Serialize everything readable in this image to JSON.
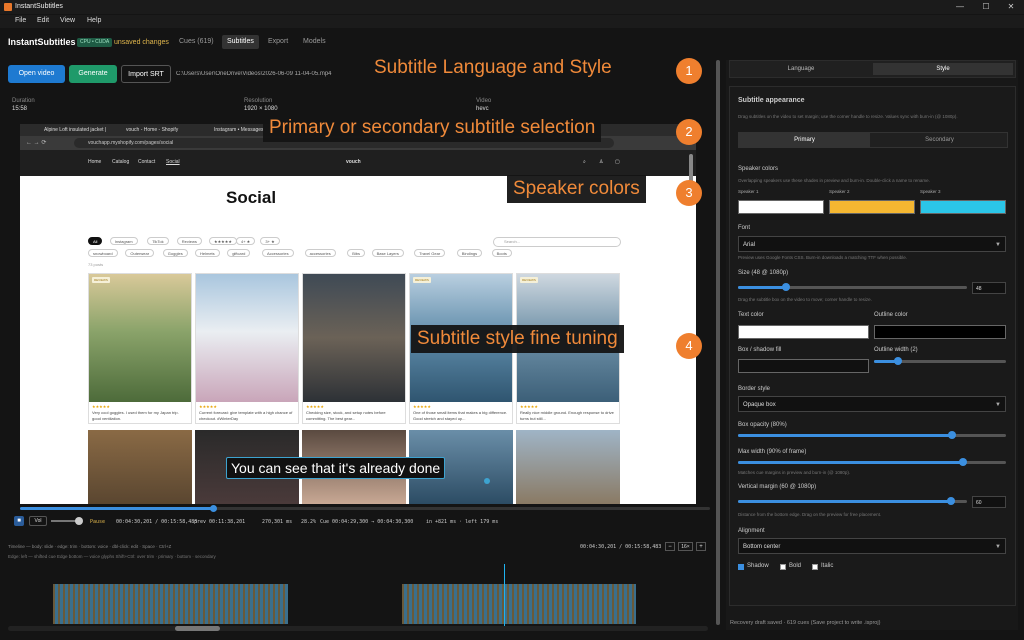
{
  "window": {
    "title": "InstantSubtitles"
  },
  "menu": [
    "File",
    "Edit",
    "View",
    "Help"
  ],
  "appbar": {
    "brand": "InstantSubtitles",
    "badge": "CPU • CUDA",
    "unsaved": "unsaved changes",
    "tabs": [
      "Cues (619)",
      "Subtitles",
      "Export",
      "Models"
    ],
    "active_tab": "Subtitles"
  },
  "toolbar": {
    "open_video": "Open video",
    "generate": "Generate",
    "import_srt": "Import SRT",
    "path": "C:\\Users\\User\\OneDrive\\Videos\\2026-06-09 11-04-05.mp4"
  },
  "info": {
    "duration_label": "Duration",
    "duration_value": "15:58",
    "resolution_label": "Resolution",
    "resolution_value": "1920 × 1080",
    "video_label": "Video",
    "video_value": "hevc"
  },
  "preview": {
    "browser_tabs": [
      "Alpine Loft insulated jacket |",
      "vouch - Home - Shopify",
      "Instagram • Messages"
    ],
    "url": "vouchapp.myshopify.com/pages/social",
    "site_nav": [
      "Home",
      "Catalog",
      "Contact",
      "Social"
    ],
    "site_logo": "vouch",
    "heading": "Social",
    "chips_row1": [
      "All",
      "Instagram",
      "TikTok",
      "Reviews",
      "★★★★★",
      "4+ ★",
      "3+ ★"
    ],
    "chips_row2": [
      "snowboard",
      "Outerwear",
      "Goggles",
      "Helmets",
      "giftcard",
      "Accessories",
      "accessories",
      "Bibs",
      "Base Layers",
      "Travel Gear",
      "Bindings",
      "Boots"
    ],
    "search_placeholder": "Search...",
    "count": "73 posts",
    "cards": [
      {
        "stars": "★★★★★",
        "text": "Very cool goggles. I used them for my Japan trip. good ventilation."
      },
      {
        "stars": "★★★★★",
        "text": "Current forecast: give template with a high chance of checkout. #WinterDay"
      },
      {
        "stars": "★★★★★",
        "text": "Checking size, stock, and setup notes before committing. The best gear..."
      },
      {
        "stars": "★★★★★",
        "text": "One of those small items that makes a big difference. Good stretch and stayed up..."
      },
      {
        "stars": "★★★★★",
        "text": "Really nice middle ground. Enough response to drive turns but still..."
      }
    ],
    "reviews_badge": "REVIEWS",
    "subtitle": "You can see that it's already done"
  },
  "callouts": [
    {
      "num": "1",
      "text": "Subtitle Language and Style"
    },
    {
      "num": "2",
      "text": "Primary or secondary subtitle selection"
    },
    {
      "num": "3",
      "text": "Speaker colors"
    },
    {
      "num": "4",
      "text": "Subtitle style fine tuning"
    }
  ],
  "transport": {
    "vol": "Vol",
    "state": "Pause",
    "time": "00:04:30,201 / 00:15:58,483",
    "prev": "prev 00:11:38,201",
    "dur": "270,301 ms",
    "pct": "28.2%",
    "cue": "Cue 00:04:29,300 → 00:04:30,300",
    "offs": "in +821 ms · left 179 ms",
    "progress": 0.28
  },
  "timeline": {
    "hint": "Timeline — body: slide · edge: trim · bottom: voice · dbl-click: edit · Space · Ctrl+Z",
    "legend": "Edge: left — shifted cue   Edge bottom — voice glyphs   Shift+Ctrl: over trim · primary · bottom · secondary",
    "time": "00:04:30,201 / 00:15:58,483",
    "zoom": "16×"
  },
  "right": {
    "tabs": [
      "Language",
      "Style"
    ],
    "active_tab": "Style",
    "section_title": "Subtitle appearance",
    "section_hint": "Drag subtitles on the video to set margin; use the corner handle to resize. Values sync with burn-in (@ 1080p).",
    "subtabs": [
      "Primary",
      "Secondary"
    ],
    "speaker_colors_label": "Speaker colors",
    "speaker_colors_hint": "Overlapping speakers use these shades in preview and burn-in. Double-click a name to rename.",
    "speakers": [
      {
        "name": "Speaker 1",
        "color": "#ffffff"
      },
      {
        "name": "Speaker 2",
        "color": "#f5b731"
      },
      {
        "name": "Speaker 3",
        "color": "#2bc6e8"
      }
    ],
    "font_label": "Font",
    "font_value": "Arial",
    "font_hint": "Preview uses Google Fonts CSS. Burn-in downloads a matching TTF when possible.",
    "size_label": "Size (48 @ 1080p)",
    "size_value": "48",
    "size_hint": "Drag the subtitle box on the video to move; corner handle to resize.",
    "size_level": 0.21,
    "text_color_label": "Text color",
    "text_color": "#ffffff",
    "outline_color_label": "Outline color",
    "outline_color": "#000000",
    "box_shadow_label": "Box / shadow fill",
    "box_color": "#111111",
    "outline_width_label": "Outline width (2)",
    "outline_level": 0.18,
    "border_style_label": "Border style",
    "border_style_value": "Opaque box",
    "box_opacity_label": "Box opacity (80%)",
    "box_opacity_level": 0.8,
    "max_width_label": "Max width (90% of frame)",
    "max_width_level": 0.84,
    "max_width_hint": "Matches cue margins in preview and burn-in (@ 1080p).",
    "vmargin_label": "Vertical margin (60 @ 1080p)",
    "vmargin_value": "60",
    "vmargin_level": 0.93,
    "vmargin_hint": "Distance from the bottom edge. Drag on the preview for free placement.",
    "alignment_label": "Alignment",
    "alignment_value": "Bottom center",
    "shadow_label": "Shadow",
    "bold_label": "Bold",
    "italic_label": "Italic",
    "status": "Recovery draft saved · 619 cues (Save project to write .isproj)"
  }
}
